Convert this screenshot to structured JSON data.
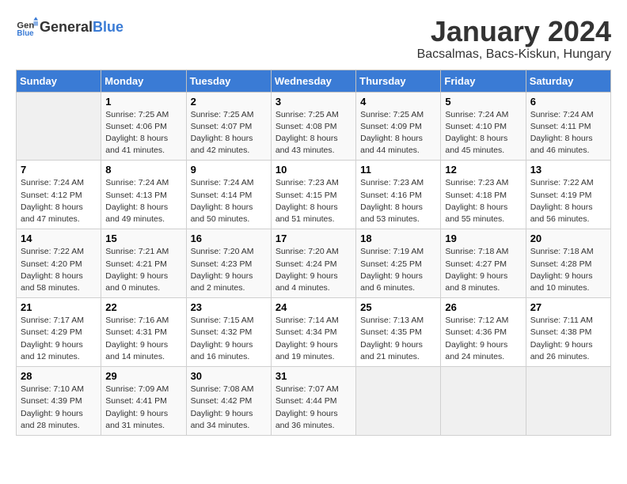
{
  "logo": {
    "text_general": "General",
    "text_blue": "Blue"
  },
  "calendar": {
    "title": "January 2024",
    "subtitle": "Bacsalmas, Bacs-Kiskun, Hungary"
  },
  "days_of_week": [
    "Sunday",
    "Monday",
    "Tuesday",
    "Wednesday",
    "Thursday",
    "Friday",
    "Saturday"
  ],
  "weeks": [
    [
      {
        "day": "",
        "sunrise": "",
        "sunset": "",
        "daylight": ""
      },
      {
        "day": "1",
        "sunrise": "Sunrise: 7:25 AM",
        "sunset": "Sunset: 4:06 PM",
        "daylight": "Daylight: 8 hours and 41 minutes."
      },
      {
        "day": "2",
        "sunrise": "Sunrise: 7:25 AM",
        "sunset": "Sunset: 4:07 PM",
        "daylight": "Daylight: 8 hours and 42 minutes."
      },
      {
        "day": "3",
        "sunrise": "Sunrise: 7:25 AM",
        "sunset": "Sunset: 4:08 PM",
        "daylight": "Daylight: 8 hours and 43 minutes."
      },
      {
        "day": "4",
        "sunrise": "Sunrise: 7:25 AM",
        "sunset": "Sunset: 4:09 PM",
        "daylight": "Daylight: 8 hours and 44 minutes."
      },
      {
        "day": "5",
        "sunrise": "Sunrise: 7:24 AM",
        "sunset": "Sunset: 4:10 PM",
        "daylight": "Daylight: 8 hours and 45 minutes."
      },
      {
        "day": "6",
        "sunrise": "Sunrise: 7:24 AM",
        "sunset": "Sunset: 4:11 PM",
        "daylight": "Daylight: 8 hours and 46 minutes."
      }
    ],
    [
      {
        "day": "7",
        "sunrise": "Sunrise: 7:24 AM",
        "sunset": "Sunset: 4:12 PM",
        "daylight": "Daylight: 8 hours and 47 minutes."
      },
      {
        "day": "8",
        "sunrise": "Sunrise: 7:24 AM",
        "sunset": "Sunset: 4:13 PM",
        "daylight": "Daylight: 8 hours and 49 minutes."
      },
      {
        "day": "9",
        "sunrise": "Sunrise: 7:24 AM",
        "sunset": "Sunset: 4:14 PM",
        "daylight": "Daylight: 8 hours and 50 minutes."
      },
      {
        "day": "10",
        "sunrise": "Sunrise: 7:23 AM",
        "sunset": "Sunset: 4:15 PM",
        "daylight": "Daylight: 8 hours and 51 minutes."
      },
      {
        "day": "11",
        "sunrise": "Sunrise: 7:23 AM",
        "sunset": "Sunset: 4:16 PM",
        "daylight": "Daylight: 8 hours and 53 minutes."
      },
      {
        "day": "12",
        "sunrise": "Sunrise: 7:23 AM",
        "sunset": "Sunset: 4:18 PM",
        "daylight": "Daylight: 8 hours and 55 minutes."
      },
      {
        "day": "13",
        "sunrise": "Sunrise: 7:22 AM",
        "sunset": "Sunset: 4:19 PM",
        "daylight": "Daylight: 8 hours and 56 minutes."
      }
    ],
    [
      {
        "day": "14",
        "sunrise": "Sunrise: 7:22 AM",
        "sunset": "Sunset: 4:20 PM",
        "daylight": "Daylight: 8 hours and 58 minutes."
      },
      {
        "day": "15",
        "sunrise": "Sunrise: 7:21 AM",
        "sunset": "Sunset: 4:21 PM",
        "daylight": "Daylight: 9 hours and 0 minutes."
      },
      {
        "day": "16",
        "sunrise": "Sunrise: 7:20 AM",
        "sunset": "Sunset: 4:23 PM",
        "daylight": "Daylight: 9 hours and 2 minutes."
      },
      {
        "day": "17",
        "sunrise": "Sunrise: 7:20 AM",
        "sunset": "Sunset: 4:24 PM",
        "daylight": "Daylight: 9 hours and 4 minutes."
      },
      {
        "day": "18",
        "sunrise": "Sunrise: 7:19 AM",
        "sunset": "Sunset: 4:25 PM",
        "daylight": "Daylight: 9 hours and 6 minutes."
      },
      {
        "day": "19",
        "sunrise": "Sunrise: 7:18 AM",
        "sunset": "Sunset: 4:27 PM",
        "daylight": "Daylight: 9 hours and 8 minutes."
      },
      {
        "day": "20",
        "sunrise": "Sunrise: 7:18 AM",
        "sunset": "Sunset: 4:28 PM",
        "daylight": "Daylight: 9 hours and 10 minutes."
      }
    ],
    [
      {
        "day": "21",
        "sunrise": "Sunrise: 7:17 AM",
        "sunset": "Sunset: 4:29 PM",
        "daylight": "Daylight: 9 hours and 12 minutes."
      },
      {
        "day": "22",
        "sunrise": "Sunrise: 7:16 AM",
        "sunset": "Sunset: 4:31 PM",
        "daylight": "Daylight: 9 hours and 14 minutes."
      },
      {
        "day": "23",
        "sunrise": "Sunrise: 7:15 AM",
        "sunset": "Sunset: 4:32 PM",
        "daylight": "Daylight: 9 hours and 16 minutes."
      },
      {
        "day": "24",
        "sunrise": "Sunrise: 7:14 AM",
        "sunset": "Sunset: 4:34 PM",
        "daylight": "Daylight: 9 hours and 19 minutes."
      },
      {
        "day": "25",
        "sunrise": "Sunrise: 7:13 AM",
        "sunset": "Sunset: 4:35 PM",
        "daylight": "Daylight: 9 hours and 21 minutes."
      },
      {
        "day": "26",
        "sunrise": "Sunrise: 7:12 AM",
        "sunset": "Sunset: 4:36 PM",
        "daylight": "Daylight: 9 hours and 24 minutes."
      },
      {
        "day": "27",
        "sunrise": "Sunrise: 7:11 AM",
        "sunset": "Sunset: 4:38 PM",
        "daylight": "Daylight: 9 hours and 26 minutes."
      }
    ],
    [
      {
        "day": "28",
        "sunrise": "Sunrise: 7:10 AM",
        "sunset": "Sunset: 4:39 PM",
        "daylight": "Daylight: 9 hours and 28 minutes."
      },
      {
        "day": "29",
        "sunrise": "Sunrise: 7:09 AM",
        "sunset": "Sunset: 4:41 PM",
        "daylight": "Daylight: 9 hours and 31 minutes."
      },
      {
        "day": "30",
        "sunrise": "Sunrise: 7:08 AM",
        "sunset": "Sunset: 4:42 PM",
        "daylight": "Daylight: 9 hours and 34 minutes."
      },
      {
        "day": "31",
        "sunrise": "Sunrise: 7:07 AM",
        "sunset": "Sunset: 4:44 PM",
        "daylight": "Daylight: 9 hours and 36 minutes."
      },
      {
        "day": "",
        "sunrise": "",
        "sunset": "",
        "daylight": ""
      },
      {
        "day": "",
        "sunrise": "",
        "sunset": "",
        "daylight": ""
      },
      {
        "day": "",
        "sunrise": "",
        "sunset": "",
        "daylight": ""
      }
    ]
  ]
}
